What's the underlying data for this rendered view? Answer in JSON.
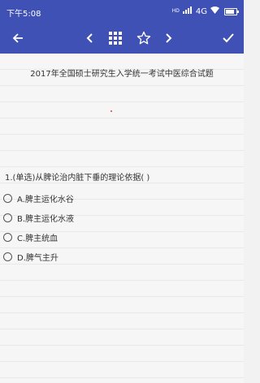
{
  "status_bar": {
    "time": "下午5:08",
    "signal_label": "HD",
    "network": "4G",
    "battery_level": 0.8
  },
  "toolbar": {
    "icons": [
      "arrow-left-icon",
      "chevron-left-icon",
      "grid-icon",
      "star-icon",
      "chevron-right-icon",
      "check-icon"
    ]
  },
  "exam": {
    "title": "2017年全国硕士研究生入学统一考试中医综合试题"
  },
  "question": {
    "text": "1.(单选)从脾论治内脏下垂的理论依据( )",
    "options": [
      {
        "label": "A.脾主运化水谷"
      },
      {
        "label": "B.脾主运化水液"
      },
      {
        "label": "C.脾主统血"
      },
      {
        "label": "D.脾气主升"
      }
    ]
  }
}
